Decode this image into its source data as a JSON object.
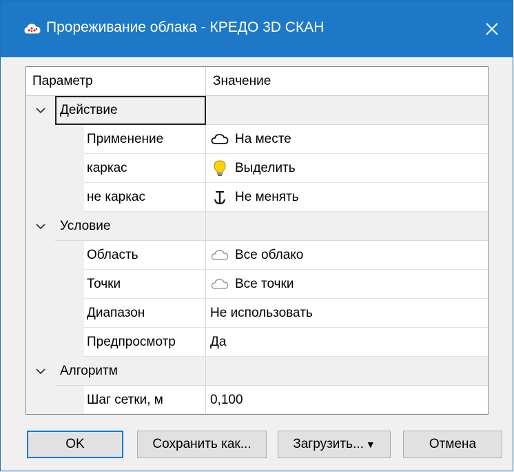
{
  "window": {
    "title": "Прореживание облака - КРЕДО 3D СКАН",
    "close_symbol": "✕"
  },
  "grid": {
    "headers": {
      "parameter": "Параметр",
      "value": "Значение"
    },
    "categories": [
      {
        "label": "Действие",
        "expanded": true,
        "properties": [
          {
            "name": "Применение",
            "value": "На месте",
            "icon": "cloud-outline-icon"
          },
          {
            "name": "каркас",
            "value": "Выделить",
            "icon": "lightbulb-icon"
          },
          {
            "name": "не каркас",
            "value": "Не менять",
            "icon": "anchor-icon"
          }
        ]
      },
      {
        "label": "Условие",
        "expanded": true,
        "properties": [
          {
            "name": "Область",
            "value": "Все облако",
            "icon": "cloud-light-icon"
          },
          {
            "name": "Точки",
            "value": "Все точки",
            "icon": "cloud-light-icon"
          },
          {
            "name": "Диапазон",
            "value": "Не использовать",
            "icon": ""
          },
          {
            "name": "Предпросмотр",
            "value": "Да",
            "icon": ""
          }
        ]
      },
      {
        "label": "Алгоритм",
        "expanded": true,
        "properties": [
          {
            "name": "Шаг сетки, м",
            "value": "0,100",
            "icon": ""
          }
        ]
      }
    ]
  },
  "buttons": {
    "ok": "OK",
    "save_as": "Сохранить как...",
    "load": "Загрузить...",
    "load_arrow": "▼",
    "cancel": "Отмена"
  },
  "colors": {
    "titlebar": "#1e78c8",
    "selection_outline": "#1f1f1f",
    "default_button_border": "#0078d7"
  }
}
